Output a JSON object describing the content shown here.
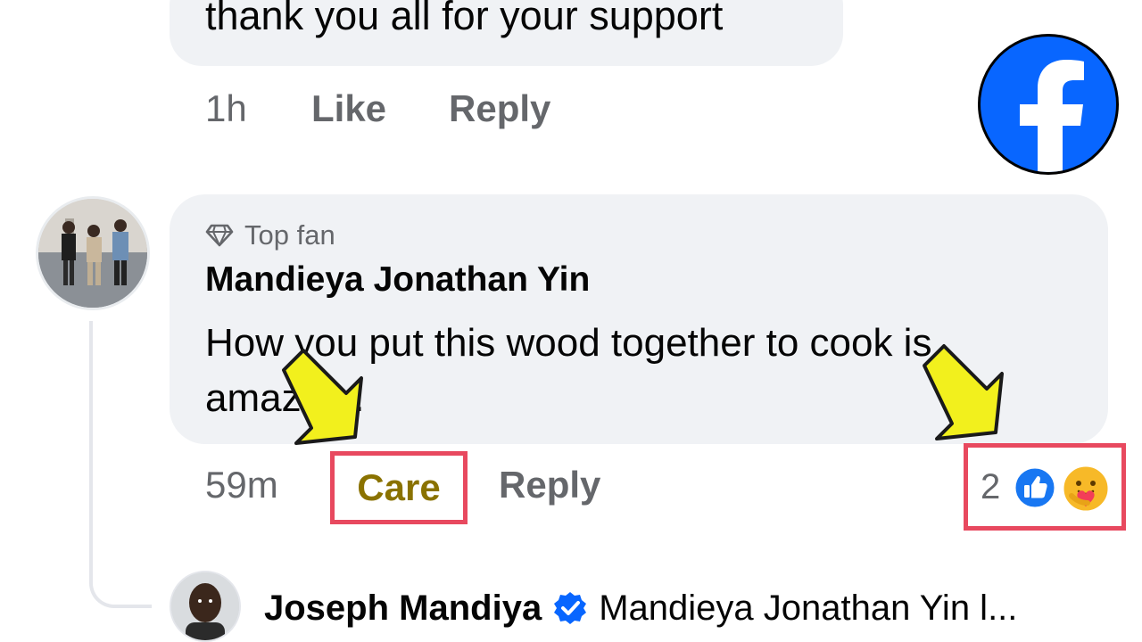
{
  "previous_comment": {
    "text": "thank you all for your support",
    "time": "1h",
    "like_label": "Like",
    "reply_label": "Reply"
  },
  "brand": {
    "logo_icon": "facebook-logo-icon",
    "logo_color": "#0866ff"
  },
  "main_comment": {
    "badge_icon": "diamond-icon",
    "badge_label": "Top fan",
    "author": "Mandieya Jonathan Yin",
    "body": "How you put this wood together to cook is amazing.",
    "time": "59m",
    "reaction_label": "Care",
    "reaction_label_color": "#8a7200",
    "reply_label": "Reply",
    "reaction_count": "2",
    "reaction_icons": [
      "like-reaction-icon",
      "care-reaction-icon"
    ]
  },
  "reply_preview": {
    "author": "Joseph Mandiya",
    "verified_icon": "verified-badge-icon",
    "text": "Mandieya Jonathan Yin l..."
  },
  "annotations": {
    "highlight_color": "#e8495f",
    "arrow_color": "#f2f01d"
  }
}
